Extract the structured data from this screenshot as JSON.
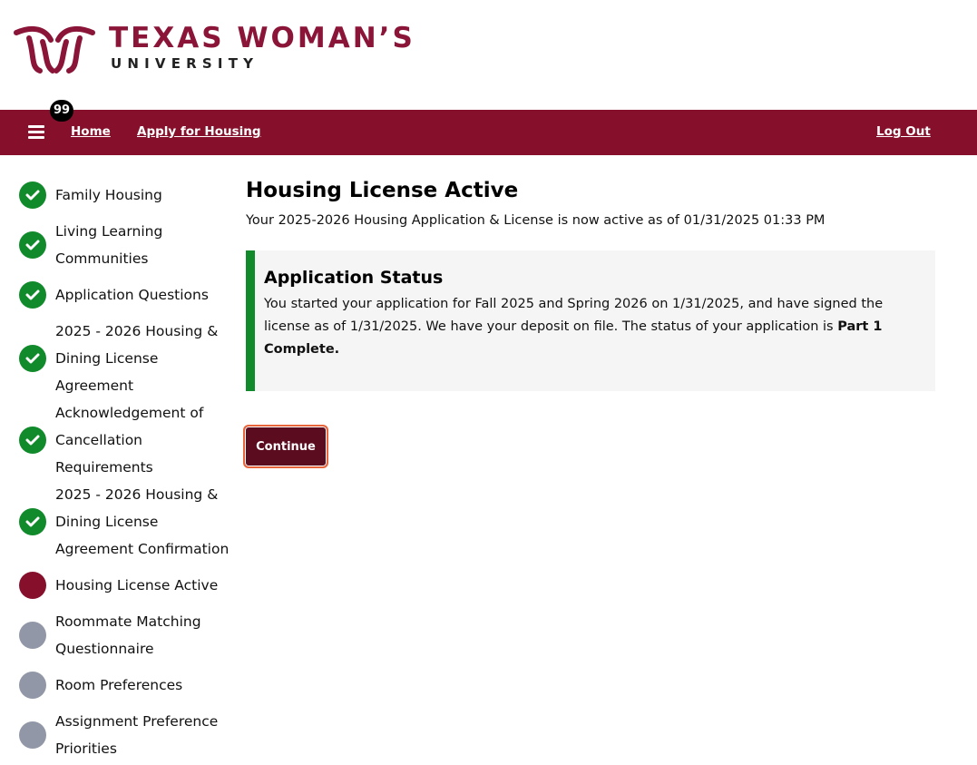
{
  "header": {
    "logo_name": "TEXAS WOMAN’S",
    "logo_sub": "UNIVERSITY"
  },
  "nav": {
    "badge_count": "99",
    "home_label": "Home",
    "apply_label": "Apply for Housing",
    "logout_label": "Log Out",
    "bar_color": "#86102b"
  },
  "steps": [
    {
      "label": "Family Housing",
      "status": "done"
    },
    {
      "label": "Living Learning Communities",
      "status": "done"
    },
    {
      "label": "Application Questions",
      "status": "done"
    },
    {
      "label": "2025 - 2026 Housing & Dining License Agreement",
      "status": "done"
    },
    {
      "label": "Acknowledgement of Cancellation Requirements",
      "status": "done"
    },
    {
      "label": "2025 - 2026 Housing & Dining License Agreement Confirmation",
      "status": "done"
    },
    {
      "label": "Housing License Active",
      "status": "current"
    },
    {
      "label": "Roommate Matching Questionnaire",
      "status": "todo"
    },
    {
      "label": "Room Preferences",
      "status": "todo"
    },
    {
      "label": "Assignment Preference Priorities",
      "status": "todo"
    }
  ],
  "main": {
    "title": "Housing License Active",
    "subtitle": "Your 2025-2026 Housing Application & License is now active as of 01/31/2025 01:33 PM",
    "status_title": "Application Status",
    "status_text": "You started your application for Fall 2025 and Spring 2026 on 1/31/2025, and have signed the license as of 1/31/2025. We have your deposit on file. The status of your application is",
    "status_value": "Part 1 Complete.",
    "continue_label": "Continue"
  },
  "colors": {
    "done": "#108a2b",
    "current": "#86102b",
    "todo": "#9197a6"
  }
}
